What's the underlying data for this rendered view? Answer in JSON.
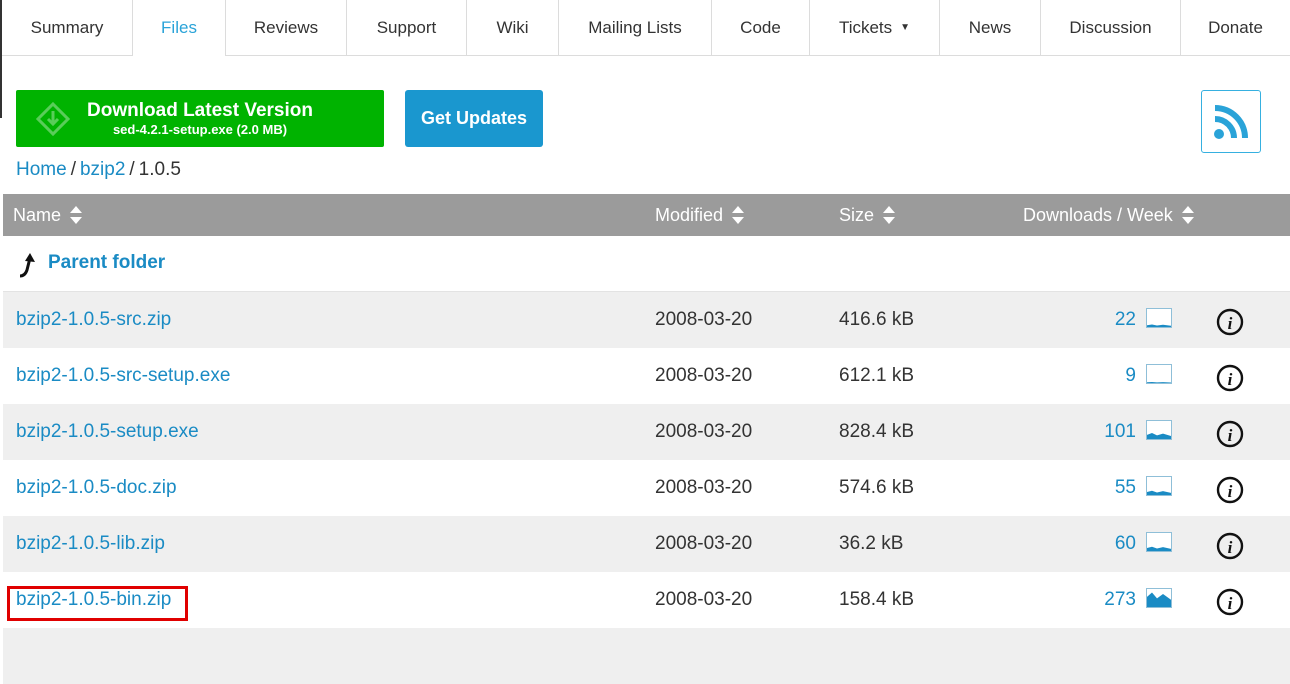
{
  "tabs": [
    {
      "label": "Summary"
    },
    {
      "label": "Files"
    },
    {
      "label": "Reviews"
    },
    {
      "label": "Support"
    },
    {
      "label": "Wiki"
    },
    {
      "label": "Mailing Lists"
    },
    {
      "label": "Code"
    },
    {
      "label": "Tickets"
    },
    {
      "label": "News"
    },
    {
      "label": "Discussion"
    },
    {
      "label": "Donate"
    }
  ],
  "active_tab": "Files",
  "download": {
    "title": "Download Latest Version",
    "subtitle": "sed-4.2.1-setup.exe (2.0 MB)"
  },
  "updates_label": "Get Updates",
  "breadcrumb": {
    "home": "Home",
    "project": "bzip2",
    "current": "1.0.5",
    "separator": "/"
  },
  "table": {
    "headers": {
      "name": "Name",
      "modified": "Modified",
      "size": "Size",
      "downloads": "Downloads / Week"
    },
    "parent_label": "Parent folder",
    "rows": [
      {
        "name": "bzip2-1.0.5-src.zip",
        "modified": "2008-03-20",
        "size": "416.6 kB",
        "downloads": "22",
        "trend": 0.15
      },
      {
        "name": "bzip2-1.0.5-src-setup.exe",
        "modified": "2008-03-20",
        "size": "612.1 kB",
        "downloads": "9",
        "trend": 0.05
      },
      {
        "name": "bzip2-1.0.5-setup.exe",
        "modified": "2008-03-20",
        "size": "828.4 kB",
        "downloads": "101",
        "trend": 0.35
      },
      {
        "name": "bzip2-1.0.5-doc.zip",
        "modified": "2008-03-20",
        "size": "574.6 kB",
        "downloads": "55",
        "trend": 0.25
      },
      {
        "name": "bzip2-1.0.5-lib.zip",
        "modified": "2008-03-20",
        "size": "36.2 kB",
        "downloads": "60",
        "trend": 0.25
      },
      {
        "name": "bzip2-1.0.5-bin.zip",
        "modified": "2008-03-20",
        "size": "158.4 kB",
        "downloads": "273",
        "trend": 0.85
      }
    ]
  },
  "colors": {
    "link": "#1a8bc4",
    "download_button": "#00b300",
    "updates_button": "#1a97cf",
    "header_bg": "#9b9b9b",
    "highlight": "#e00000"
  },
  "icons": {
    "sort": "sort-icon",
    "rss": "rss-icon",
    "parent": "arrow-up-icon",
    "info": "info-icon",
    "sparkline": "sparkline-icon",
    "dropdown": "caret-down-icon"
  }
}
